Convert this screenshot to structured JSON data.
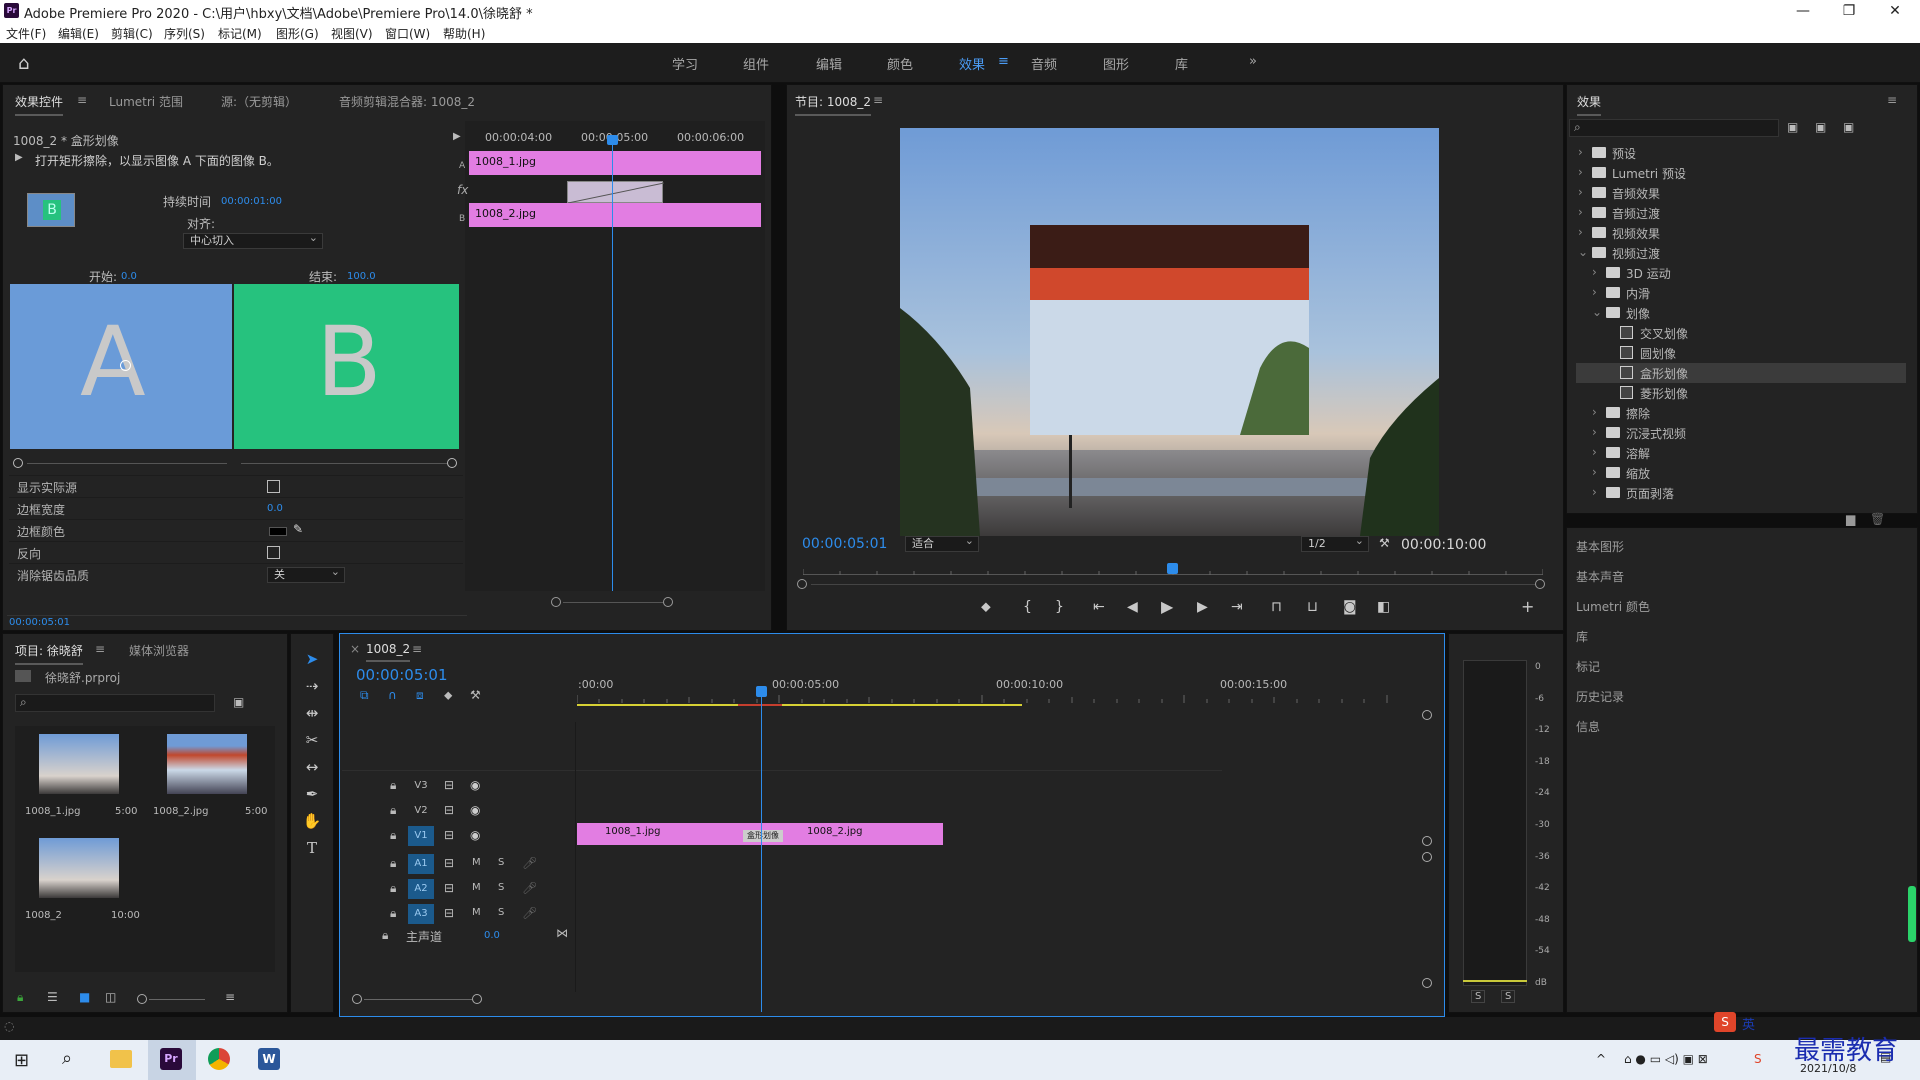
{
  "window": {
    "title": "Adobe Premiere Pro 2020 - C:\\用户\\hbxy\\文档\\Adobe\\Premiere Pro\\14.0\\徐晓舒 *"
  },
  "menu": [
    "文件(F)",
    "编辑(E)",
    "剪辑(C)",
    "序列(S)",
    "标记(M)",
    "图形(G)",
    "视图(V)",
    "窗口(W)",
    "帮助(H)"
  ],
  "workspaces": [
    "学习",
    "组件",
    "编辑",
    "颜色",
    "效果",
    "音频",
    "图形",
    "库"
  ],
  "active_workspace": "效果",
  "effect_controls": {
    "tabs": [
      "效果控件",
      "Lumetri 范围",
      "源:（无剪辑）",
      "音频剪辑混合器: 1008_2"
    ],
    "clip_name": "1008_2 * 盒形划像",
    "description": "打开矩形擦除，以显示图像 A 下面的图像 B。",
    "badge_letter": "B",
    "duration_label": "持续时间",
    "duration_value": "00:00:01:00",
    "align_label": "对齐:",
    "align_value": "中心切入",
    "start_label": "开始:",
    "start_value": "0.0",
    "end_label": "结束:",
    "end_value": "100.0",
    "letter_a": "A",
    "letter_b": "B",
    "properties": [
      {
        "label": "显示实际源",
        "value": ""
      },
      {
        "label": "边框宽度",
        "value": "0.0"
      },
      {
        "label": "边框颜色",
        "value": ""
      },
      {
        "label": "反向",
        "value": ""
      },
      {
        "label": "消除锯齿品质",
        "value": "关"
      }
    ],
    "timecode": "00:00:05:01",
    "mini_times": [
      "00:00:04:00",
      "00:00:05:00",
      "00:00:06:00"
    ],
    "mini_clip_a": "1008_1.jpg",
    "mini_clip_b": "1008_2.jpg",
    "label_a": "A",
    "label_b": "B",
    "fx": "fx"
  },
  "program": {
    "title": "节目: 1008_2",
    "timecode": "00:00:05:01",
    "fit": "适合",
    "scale": "1/2",
    "duration": "00:00:10:00"
  },
  "effects_panel": {
    "title": "效果",
    "tree": [
      {
        "label": "预设",
        "level": 0,
        "kind": "folder",
        "arrow": "›"
      },
      {
        "label": "Lumetri 预设",
        "level": 0,
        "kind": "folder",
        "arrow": "›"
      },
      {
        "label": "音频效果",
        "level": 0,
        "kind": "folder",
        "arrow": "›"
      },
      {
        "label": "音频过渡",
        "level": 0,
        "kind": "folder",
        "arrow": "›"
      },
      {
        "label": "视频效果",
        "level": 0,
        "kind": "folder",
        "arrow": "›"
      },
      {
        "label": "视频过渡",
        "level": 0,
        "kind": "folder",
        "arrow": "⌄"
      },
      {
        "label": "3D 运动",
        "level": 1,
        "kind": "folder",
        "arrow": "›"
      },
      {
        "label": "内滑",
        "level": 1,
        "kind": "folder",
        "arrow": "›"
      },
      {
        "label": "划像",
        "level": 1,
        "kind": "folder",
        "arrow": "⌄"
      },
      {
        "label": "交叉划像",
        "level": 2,
        "kind": "effect",
        "arrow": ""
      },
      {
        "label": "圆划像",
        "level": 2,
        "kind": "effect",
        "arrow": ""
      },
      {
        "label": "盒形划像",
        "level": 2,
        "kind": "effect",
        "arrow": "",
        "selected": true
      },
      {
        "label": "菱形划像",
        "level": 2,
        "kind": "effect",
        "arrow": ""
      },
      {
        "label": "擦除",
        "level": 1,
        "kind": "folder",
        "arrow": "›"
      },
      {
        "label": "沉浸式视频",
        "level": 1,
        "kind": "folder",
        "arrow": "›"
      },
      {
        "label": "溶解",
        "level": 1,
        "kind": "folder",
        "arrow": "›"
      },
      {
        "label": "缩放",
        "level": 1,
        "kind": "folder",
        "arrow": "›"
      },
      {
        "label": "页面剥落",
        "level": 1,
        "kind": "folder",
        "arrow": "›"
      }
    ],
    "sections": [
      "基本图形",
      "基本声音",
      "Lumetri 颜色",
      "库",
      "标记",
      "历史记录",
      "信息"
    ]
  },
  "project": {
    "tabs": [
      "项目: 徐晓舒",
      "媒体浏览器"
    ],
    "file": "徐晓舒.prproj",
    "items": [
      {
        "name": "1008_1.jpg",
        "dur": "5:00"
      },
      {
        "name": "1008_2.jpg",
        "dur": "5:00"
      },
      {
        "name": "1008_2",
        "dur": "10:00"
      }
    ]
  },
  "timeline": {
    "tab": "1008_2",
    "timecode": "00:00:05:01",
    "ruler": [
      ":00:00",
      "00:00:05:00",
      "00:00:10:00",
      "00:00:15:00"
    ],
    "tracks": [
      {
        "id": "V3",
        "extra": ""
      },
      {
        "id": "V2",
        "extra": ""
      },
      {
        "id": "V1",
        "extra": ""
      },
      {
        "id": "A1",
        "extra": "M"
      },
      {
        "id": "A2",
        "extra": "M"
      },
      {
        "id": "A3",
        "extra": "M"
      }
    ],
    "solo": "S",
    "master_label": "主声道",
    "master_value": "0.0",
    "clip1": "1008_1.jpg",
    "clip2": "1008_2.jpg",
    "transition": "盒形划像"
  },
  "meter": {
    "scale": [
      "0",
      "-6",
      "-12",
      "-18",
      "-24",
      "-30",
      "-36",
      "-42",
      "-48",
      "-54",
      "dB"
    ],
    "solo_a": "S",
    "solo_b": "S"
  },
  "taskbar": {
    "ime": "英",
    "watermark": "最需教育",
    "date": "2021/10/8"
  },
  "colors": {
    "accent": "#2d8ceb",
    "clip": "#e27de2",
    "panel": "#232323",
    "a_box": "#6a9bd8",
    "b_box": "#26c27e"
  }
}
